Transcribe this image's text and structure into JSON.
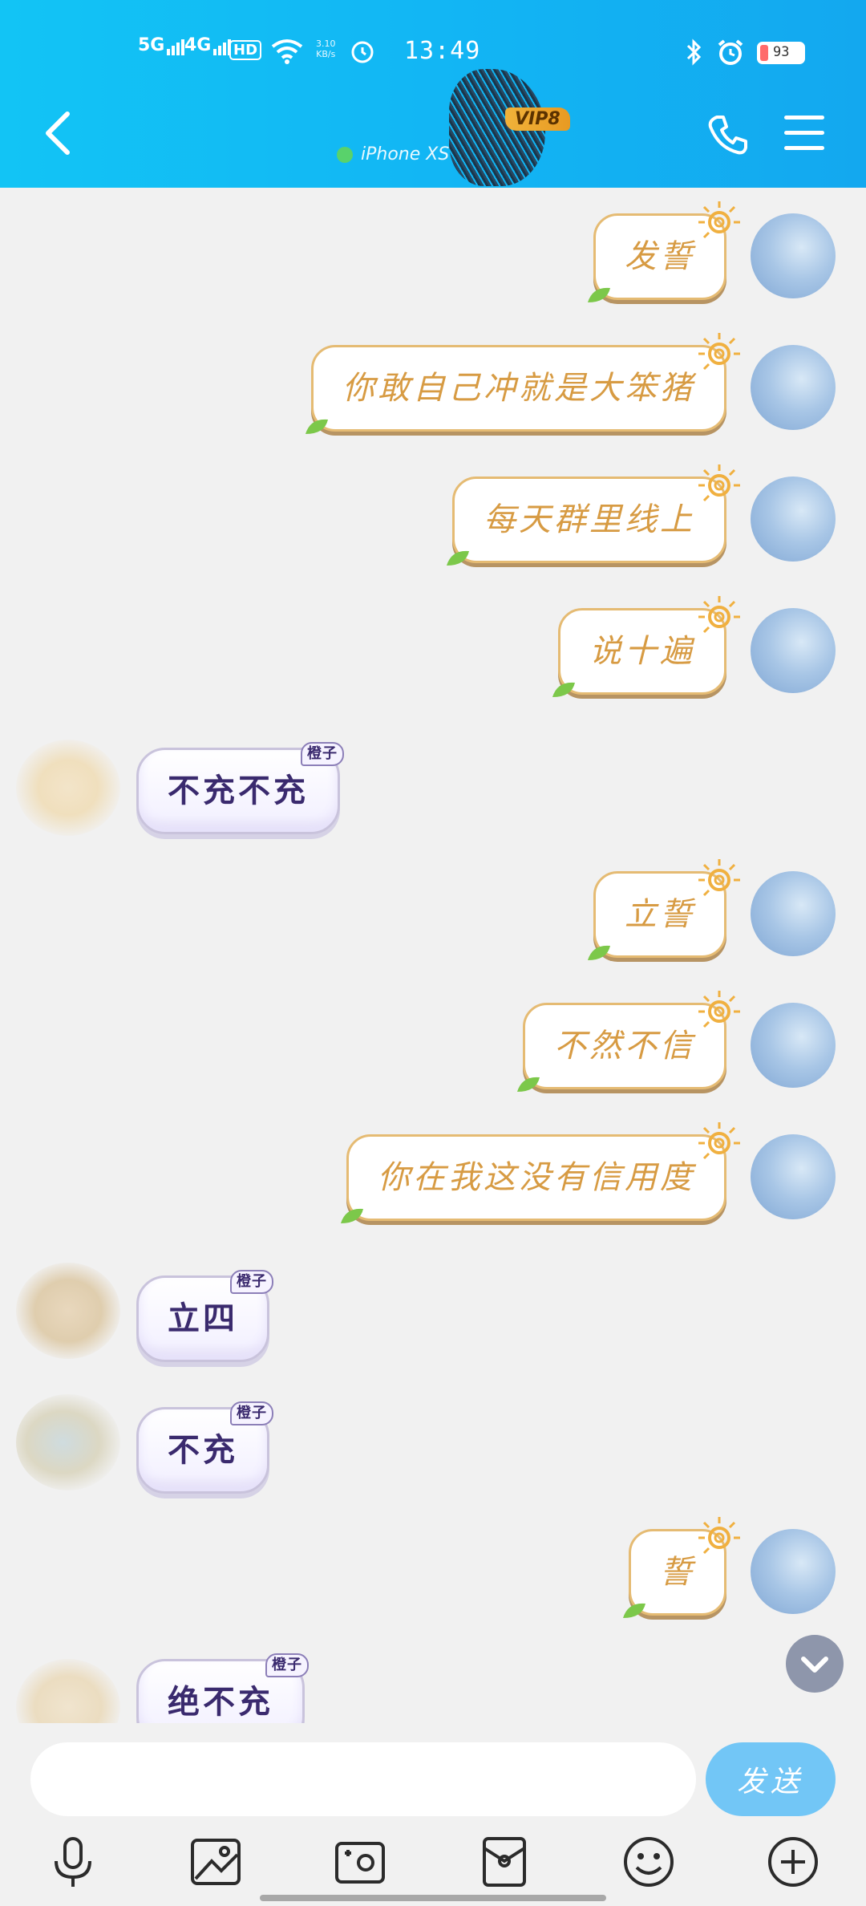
{
  "status_bar": {
    "signal_1": "5G",
    "signal_2": "4G",
    "hd": "HD",
    "net_speed_value": "3.10",
    "net_speed_unit": "KB/s",
    "time": "13:49",
    "battery": "93"
  },
  "header": {
    "vip_badge": "VIP8",
    "device": "iPhone XS",
    "accent": "#12b6f4"
  },
  "messages": [
    {
      "side": "out",
      "text": "发誓"
    },
    {
      "side": "out",
      "text": "你敢自己冲就是大笨猪"
    },
    {
      "side": "out",
      "text": "每天群里线上"
    },
    {
      "side": "out",
      "text": "说十遍"
    },
    {
      "side": "in",
      "text": "不充不充",
      "tag": "橙子"
    },
    {
      "side": "out",
      "text": "立誓"
    },
    {
      "side": "out",
      "text": "不然不信"
    },
    {
      "side": "out",
      "text": "你在我这没有信用度"
    },
    {
      "side": "in",
      "text": "立四",
      "tag": "橙子"
    },
    {
      "side": "in",
      "text": "不充",
      "tag": "橙子"
    },
    {
      "side": "out",
      "text": "誓"
    },
    {
      "side": "in",
      "text": "绝不充",
      "tag": "橙子"
    }
  ],
  "input": {
    "placeholder": "",
    "send_label": "发送"
  },
  "toolbar": {
    "items": [
      "mic-icon",
      "image-icon",
      "camera-icon",
      "red-packet-icon",
      "emoji-icon",
      "plus-icon"
    ]
  }
}
